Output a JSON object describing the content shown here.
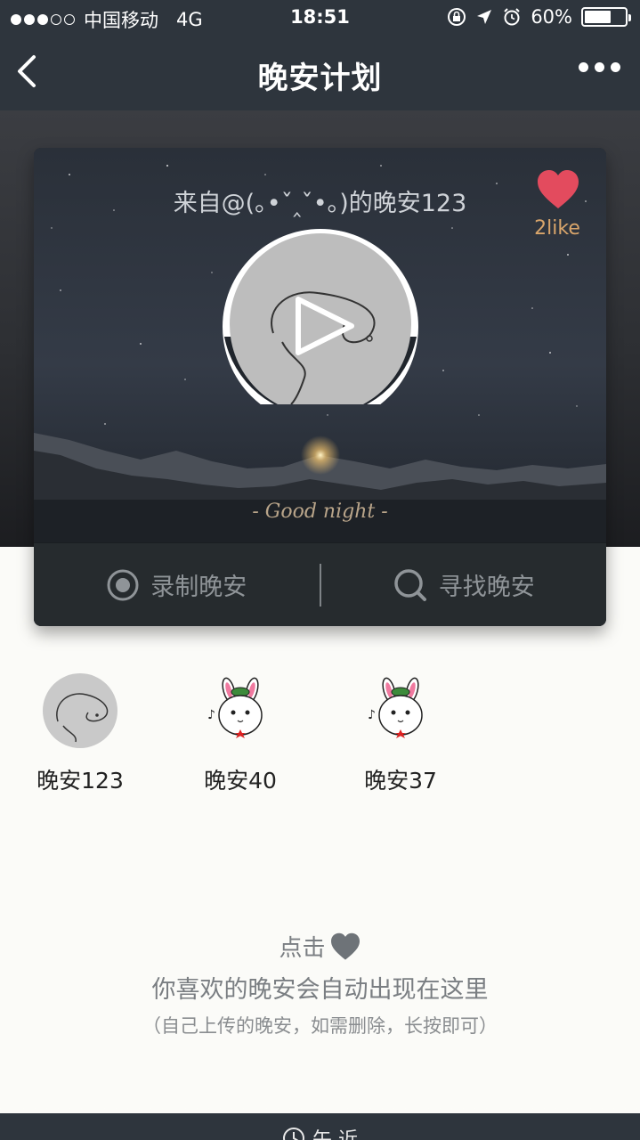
{
  "status": {
    "carrier": "中国移动",
    "network": "4G",
    "time": "18:51",
    "battery": "60%",
    "battery_level": 0.6
  },
  "nav": {
    "title": "晚安计划"
  },
  "card": {
    "heading": "来自@(｡•ˇ‸ˇ•｡)的晚安123",
    "like_count": "2like",
    "caption": "- Good night -",
    "record_label": "录制晚安",
    "find_label": "寻找晚安"
  },
  "recent": [
    {
      "name": "晚安123",
      "thumb": "doodle-avatar"
    },
    {
      "name": "晚安40",
      "thumb": "bunny-avatar"
    },
    {
      "name": "晚安37",
      "thumb": "bunny-avatar"
    }
  ],
  "hint": {
    "line1_prefix": "点击",
    "line2": "你喜欢的晚安会自动出现在这里",
    "line3": "（自己上传的晚安，如需删除，长按即可）"
  },
  "bottom": {
    "label": "午 近"
  },
  "colors": {
    "bar": "#2e353d",
    "heart": "#e34b5e",
    "like": "#d9a56b"
  }
}
